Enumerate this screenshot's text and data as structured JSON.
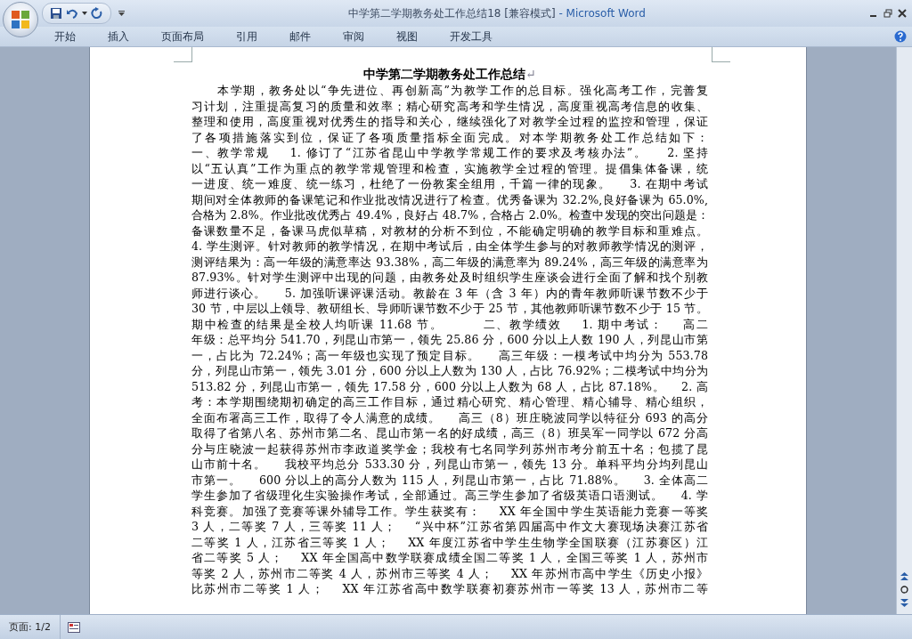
{
  "window": {
    "title": "中学第二学期教务处工作总结18 [兼容模式]",
    "app_name": "- Microsoft Word"
  },
  "ribbon_tabs": [
    {
      "label": "开始",
      "selected": false
    },
    {
      "label": "插入",
      "selected": false
    },
    {
      "label": "页面布局",
      "selected": false
    },
    {
      "label": "引用",
      "selected": false
    },
    {
      "label": "邮件",
      "selected": false
    },
    {
      "label": "审阅",
      "selected": false
    },
    {
      "label": "视图",
      "selected": false
    },
    {
      "label": "开发工具",
      "selected": false
    }
  ],
  "document": {
    "title": "中学第二学期教务处工作总结",
    "paragraph_mark": "↵",
    "lines": [
      "　　本学期，教务处以“争先进位、再创新高”为教学工作的总目标。强化高考工作，完善复",
      "习计划，注重提高复习的质量和效率；精心研究高考和学生情况，高度重视高考信息的收集、",
      "整理和使用，高度重视对优秀生的指导和关心，继续强化了对教学全过程的监控和管理，保证",
      "了各项措施落实到位，保证了各项质量指标全面完成。对本学期教务处工作总结如下：",
      "一、教学常规    1. 修订了“江苏省昆山中学教学常规工作的要求及考核办法”。    2. 坚持",
      "以“五认真”工作为重点的教学常规管理和检查，实施教学全过程的管理。提倡集体备课，统",
      "一进度、统一难度、统一练习，杜绝了一份教案全组用，千篇一律的现象。    3. 在期中考试",
      "期间对全体教师的备课笔记和作业批改情况进行了检查。优秀备课为 32.2%,良好备课为 65.0%,",
      "合格为 2.8%。作业批改优秀占 49.4%，良好占 48.7%，合格占 2.0%。检查中发现的突出问题是：",
      "备课数量不足，备课马虎似草稿，对教材的分析不到位，不能确定明确的教学目标和重难点。",
      "4. 学生测评。针对教师的教学情况，在期中考试后，由全体学生参与的对教师教学情况的测评，",
      "测评结果为：高一年级的满意率达 93.38%，高二年级的满意率为 89.24%，高三年级的满意率为",
      "87.93%。针对学生测评中出现的问题，由教务处及时组织学生座谈会进行全面了解和找个别教",
      "师进行谈心。    5. 加强听课评课活动。教龄在 3 年（含 3 年）内的青年教师听课节数不少于",
      "30 节，中层以上领导、教研组长、导师听课节数不少于 25 节，其他教师听课节数不少于 15 节。",
      "期中检查的结果是全校人均听课 11.68 节。        二、教学绩效    1. 期中考试：    高二",
      "年级：总平均分 541.70，列昆山市第一，领先 25.86 分，600 分以上人数 190 人，列昆山市第",
      "一，占比为 72.24%；高一年级也实现了预定目标。    高三年级：一模考试中均分为 553.78",
      "分，列昆山市第一，领先 3.01 分，600 分以上人数为 130 人，占比 76.92%；二模考试中均分为",
      "513.82 分，列昆山市第一，领先 17.58 分，600 分以上人数为 68 人，占比 87.18%。    2. 高",
      "考：本学期围绕期初确定的高三工作目标，通过精心研究、精心管理、精心辅导、精心组织，",
      "全面布署高三工作，取得了令人满意的成绩。    高三（8）班庄晓波同学以特征分 693 的高分",
      "取得了省第八名、苏州市第二名、昆山市第一名的好成绩，高三（8）班吴军一同学以 672 分高",
      "分与庄晓波一起获得苏州市李政道奖学金；我校有七名同学列苏州市考分前五十名；包揽了昆",
      "山市前十名。    我校平均总分 533.30 分，列昆山市第一，领先 13 分。单科平均分均列昆山",
      "市第一。    600 分以上的高分人数为 115 人，列昆山市第一，占比 71.88%。    3. 全体高二",
      "学生参加了省级理化生实验操作考试，全部通过。高三学生参加了省级英语口语测试。    4. 学",
      "科竞赛。加强了竞赛等课外辅导工作。学生获奖有：    XX 年全国中学生英语能力竞赛一等奖",
      "3 人，二等奖 7 人，三等奖 11 人；    “兴中杯”江苏省第四届高中作文大赛现场决赛江苏省",
      "二等奖 1 人，江苏省三等奖 1 人；    XX 年度江苏省中学生生物学全国联赛（江苏赛区）江",
      "省二等奖 5 人；    XX 年全国高中数学联赛成绩全国二等奖 1 人，全国三等奖 1 人，苏州市",
      "等奖 2 人，苏州市二等奖 4 人，苏州市三等奖 4 人；    XX 年苏州市高中学生《历史小报》",
      "比苏州市二等奖 1 人；    XX 年江苏省高中数学联赛初赛苏州市一等奖 13 人，苏州市二等"
    ]
  },
  "status_bar": {
    "page": "页面: 1/2"
  }
}
